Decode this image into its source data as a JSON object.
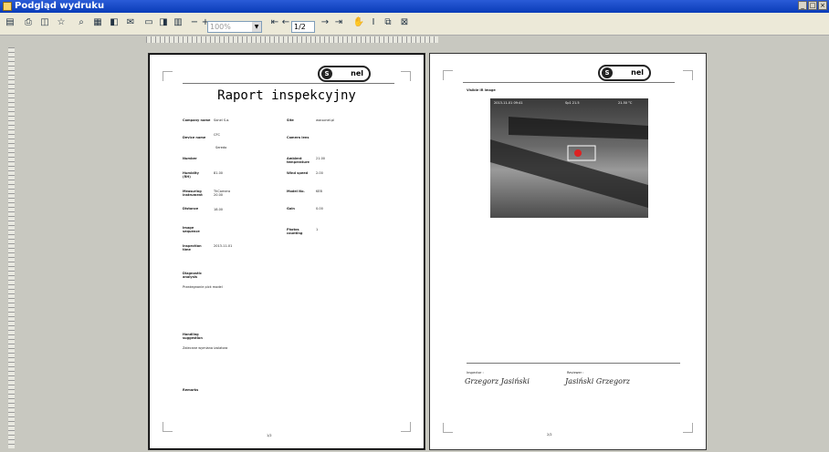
{
  "window": {
    "title": "Podgląd wydruku"
  },
  "toolbar": {
    "zoom_value": "100%",
    "page_value": "1/2"
  },
  "page1": {
    "report_title": "Raport inspekcyjny",
    "fields": [
      {
        "label": "Company name",
        "value": "Sonel S.a."
      },
      {
        "label": "Site",
        "value": "ww.sonel.pl"
      },
      {
        "label": "Device name",
        "value": "CFC"
      },
      {
        "label": "Camera lens",
        "value": ""
      },
      {
        "label": "",
        "value": "Seredo"
      },
      {
        "label": "Number",
        "value": ""
      },
      {
        "label": "Ambient temperature",
        "value": "21.00"
      },
      {
        "label": "Humidity (RH)",
        "value": "81.00"
      },
      {
        "label": "Wind speed",
        "value": "2.00"
      },
      {
        "label": "Measuring instrument",
        "value": "ThCamera 20.00"
      },
      {
        "label": "Model No.",
        "value": "KEB"
      },
      {
        "label": "Distance",
        "value": "18.00"
      },
      {
        "label": "Gain",
        "value": "0.00"
      },
      {
        "label": "Image sequence",
        "value": ""
      },
      {
        "label": "Photos counting",
        "value": "1"
      },
      {
        "label": "Inspection time",
        "value": "2013-11-01"
      }
    ],
    "diagnostic_label": "Diagnostic analysis",
    "diagnostic_value": "Przeżegnanie pick model",
    "handling_label": "Handling suggestion",
    "handling_value": "Zalecane wymiana izolatora",
    "remarks_label": "Remarks",
    "page_num": "1/2"
  },
  "page2": {
    "image_label": "Visible IR image",
    "thermo_text_left": "2013-11-01 09:41",
    "thermo_text_mid": "Sp1 21.5",
    "thermo_text_right": "21.50 °C",
    "inspector_label": "Inspector :",
    "inspector_sign": "Grzegorz Jasiński",
    "reviewer_label": "Reviewer :",
    "reviewer_sign": "Jasiński Grzegorz",
    "page_num": "2/2"
  }
}
